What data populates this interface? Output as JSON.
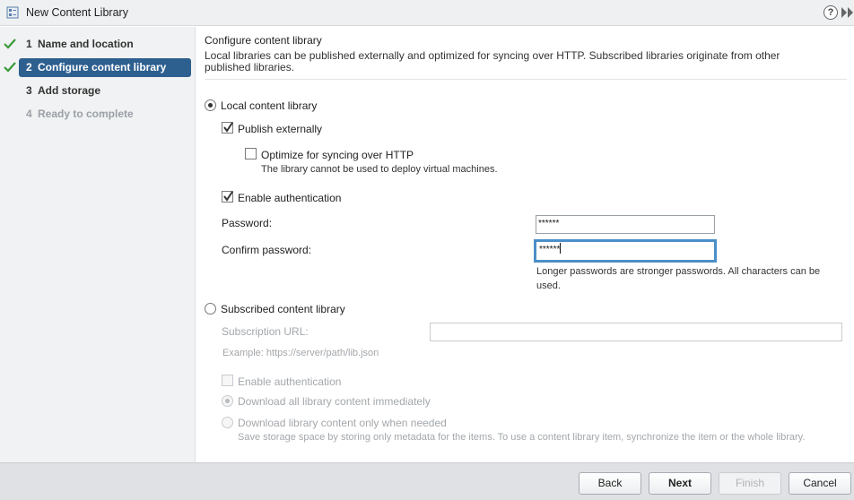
{
  "window": {
    "title": "New Content Library"
  },
  "steps": [
    {
      "num": "1",
      "label": "Name and location",
      "state": "done"
    },
    {
      "num": "2",
      "label": "Configure content library",
      "state": "active"
    },
    {
      "num": "3",
      "label": "Add storage",
      "state": "todo"
    },
    {
      "num": "4",
      "label": "Ready to complete",
      "state": "disabled"
    }
  ],
  "header": {
    "title": "Configure content library",
    "description": "Local libraries can be published externally and optimized for syncing over HTTP. Subscribed libraries originate from other published libraries."
  },
  "local": {
    "label": "Local content library",
    "selected": true,
    "publish_label": "Publish externally",
    "publish_checked": true,
    "optimize_label": "Optimize for syncing over HTTP",
    "optimize_checked": false,
    "optimize_note": "The library cannot be used to deploy virtual machines.",
    "auth_label": "Enable authentication",
    "auth_checked": true,
    "password_label": "Password:",
    "password_value": "******",
    "confirm_label": "Confirm password:",
    "confirm_value": "******",
    "password_hint_line1": "Longer passwords are stronger passwords. All characters can be",
    "password_hint_line2": "used."
  },
  "subscribed": {
    "label": "Subscribed content library",
    "selected": false,
    "url_label": "Subscription URL:",
    "url_value": "",
    "url_example": "Example: https://server/path/lib.json",
    "auth_label": "Enable authentication",
    "download_all_label": "Download all library content immediately",
    "download_needed_label": "Download library content only when needed",
    "download_needed_note": "Save storage space by storing only metadata for the items. To use a content library item, synchronize the item or the whole library."
  },
  "footer": {
    "back_label": "Back",
    "next_label": "Next",
    "finish_label": "Finish",
    "cancel_label": "Cancel"
  },
  "icons": {
    "check": "check-icon",
    "help": "help-icon",
    "collapse": "collapse-icon",
    "wizard": "wizard-icon"
  },
  "colors": {
    "accent": "#2d5f8f",
    "check_green": "#3b9a3b",
    "focus_border": "#4b8fc7"
  }
}
